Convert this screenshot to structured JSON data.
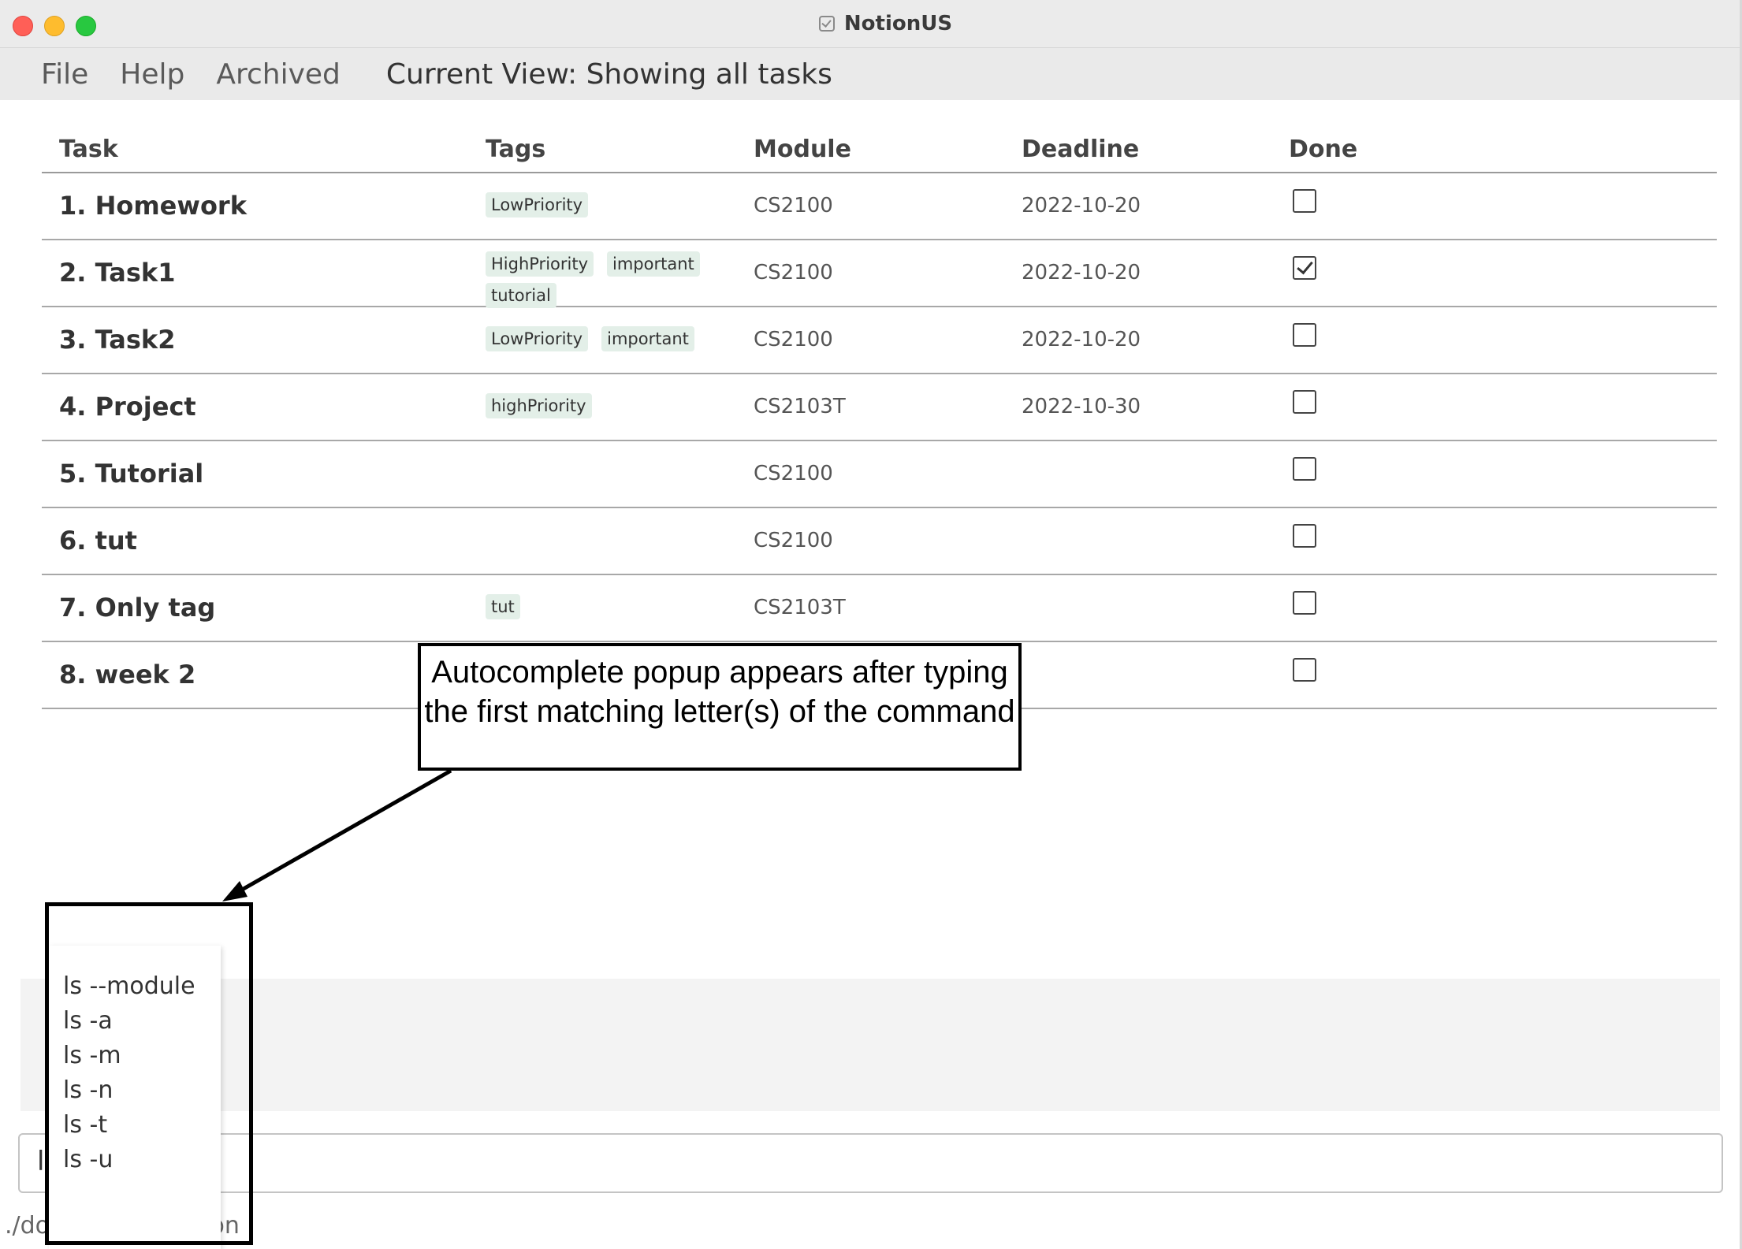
{
  "window": {
    "title": "NotionUS"
  },
  "menu": {
    "file": "File",
    "help": "Help",
    "archived": "Archived",
    "current_view": "Current View: Showing all tasks"
  },
  "table": {
    "headers": [
      "Task",
      "Tags",
      "Module",
      "Deadline",
      "Done"
    ],
    "rows": [
      {
        "task": "1. Homework",
        "tags": [
          "LowPriority"
        ],
        "module": "CS2100",
        "deadline": "2022-10-20",
        "done": false
      },
      {
        "task": "2. Task1",
        "tags": [
          "HighPriority",
          "important",
          "tutorial"
        ],
        "module": "CS2100",
        "deadline": "2022-10-20",
        "done": true
      },
      {
        "task": "3. Task2",
        "tags": [
          "LowPriority",
          "important"
        ],
        "module": "CS2100",
        "deadline": "2022-10-20",
        "done": false
      },
      {
        "task": "4. Project",
        "tags": [
          "highPriority"
        ],
        "module": "CS2103T",
        "deadline": "2022-10-30",
        "done": false
      },
      {
        "task": "5. Tutorial",
        "tags": [],
        "module": "CS2100",
        "deadline": "",
        "done": false
      },
      {
        "task": "6. tut",
        "tags": [],
        "module": "CS2100",
        "deadline": "",
        "done": false
      },
      {
        "task": "7. Only tag",
        "tags": [
          "tut"
        ],
        "module": "CS2103T",
        "deadline": "",
        "done": false
      },
      {
        "task": "8. week 2",
        "tags": [],
        "module": "",
        "deadline": "",
        "done": false
      }
    ]
  },
  "command_box": {
    "value": "l"
  },
  "status_bar": {
    "left": "./do",
    "right": ".json"
  },
  "autocomplete": {
    "items": [
      "ls --module",
      "ls -a",
      "ls -m",
      "ls -n",
      "ls -t",
      "ls -u"
    ]
  },
  "annotation": {
    "text": "Autocomplete popup appears after typing the first matching letter(s) of the command"
  },
  "colors": {
    "tag_bg": "#e3efe8",
    "close": "#ff5f57",
    "minimize": "#febc2e",
    "maximize": "#28c840"
  }
}
